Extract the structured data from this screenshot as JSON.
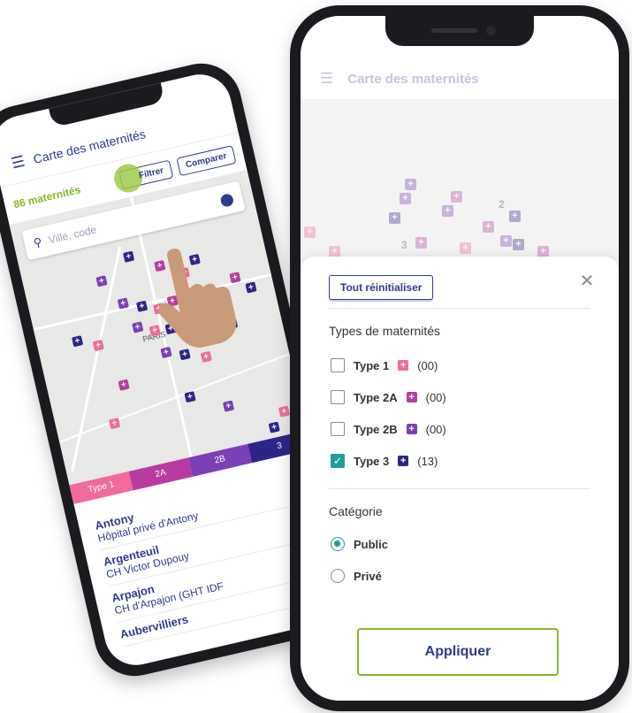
{
  "left_phone": {
    "header_title": "Carte des maternités",
    "count_label": "86 maternités",
    "filter_button": "Filtrer",
    "compare_button": "Comparer",
    "search_placeholder": "Ville, code",
    "map_city_label": "PARIS",
    "legend": [
      {
        "label": "Type 1",
        "color": "#f06a9e"
      },
      {
        "label": "2A",
        "color": "#b83ca0"
      },
      {
        "label": "2B",
        "color": "#7b3fb6"
      },
      {
        "label": "3",
        "color": "#2d2689"
      }
    ],
    "list": [
      {
        "city": "Antony",
        "hospital": "Hôpital privé d'Antony"
      },
      {
        "city": "Argenteuil",
        "hospital": "CH Victor Dupouy"
      },
      {
        "city": "Arpajon",
        "hospital": "CH d'Arpajon (GHT IDF"
      },
      {
        "city": "Aubervilliers",
        "hospital": ""
      }
    ]
  },
  "right_phone": {
    "header_title": "Carte des maternités",
    "map_cluster_numbers": [
      "2",
      "3"
    ],
    "reset_button": "Tout réinitialiser",
    "types_section_title": "Types de maternités",
    "types": [
      {
        "label": "Type 1",
        "count": "(00)",
        "checked": false,
        "color": "#f06a9e"
      },
      {
        "label": "Type 2A",
        "count": "(00)",
        "checked": false,
        "color": "#b83ca0"
      },
      {
        "label": "Type 2B",
        "count": "(00)",
        "checked": false,
        "color": "#7b3fb6"
      },
      {
        "label": "Type 3",
        "count": "(13)",
        "checked": true,
        "color": "#2d2689"
      }
    ],
    "category_section_title": "Catégorie",
    "categories": [
      {
        "label": "Public",
        "selected": true
      },
      {
        "label": "Privé",
        "selected": false
      }
    ],
    "apply_button": "Appliquer"
  },
  "colors": {
    "brand_blue": "#2e3a8c",
    "accent_green": "#84b82c",
    "check_teal": "#1f9e95"
  }
}
